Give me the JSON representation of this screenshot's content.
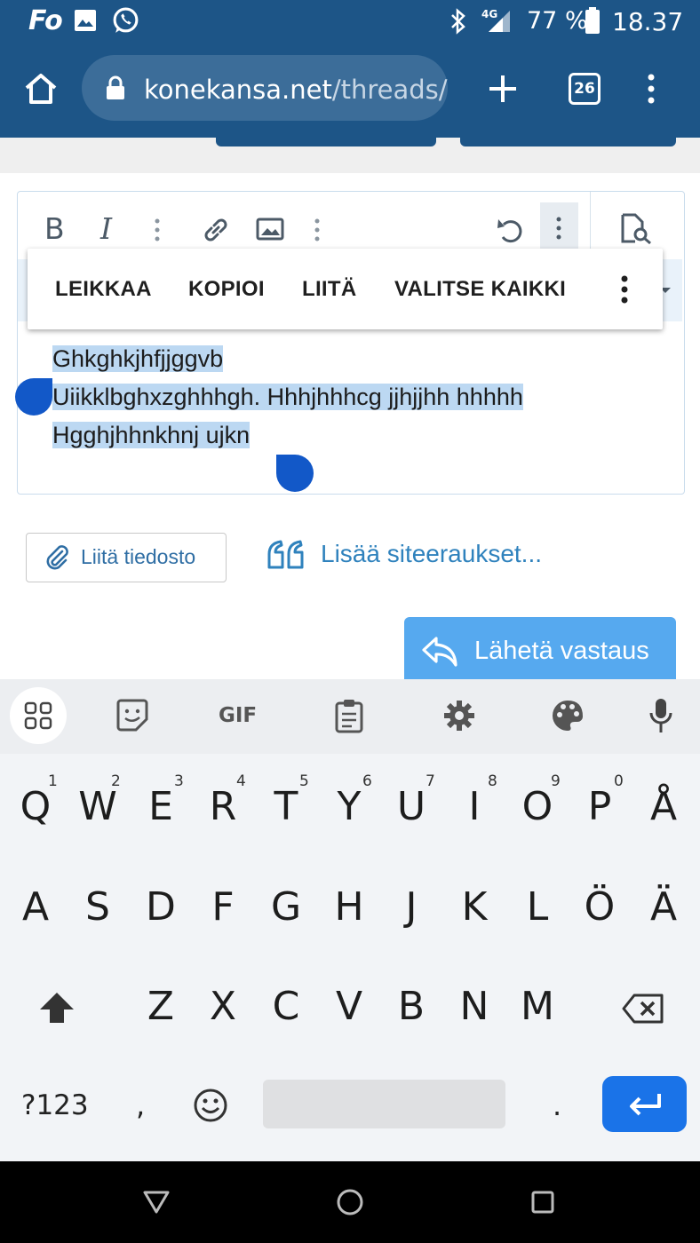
{
  "status_bar": {
    "app_label": "Fo",
    "network": "4G",
    "battery": "77 %",
    "time": "18.37"
  },
  "browser": {
    "url_host": "konekansa.net",
    "url_path": "/threads/",
    "tab_count": "26"
  },
  "context_menu": {
    "items": [
      "LEIKKAA",
      "KOPIOI",
      "LIITÄ",
      "VALITSE KAIKKI"
    ]
  },
  "editor": {
    "lines": [
      "Ghkghkjhfjjggvb",
      "Uiikklbghxzghhhgh. Hhhjhhhcg jjhjjhh hhhhh",
      "Hgghjhhnkhnj ujkn"
    ]
  },
  "actions": {
    "attach_label": "Liitä tiedosto",
    "quote_label": "Lisää siteeraukset...",
    "send_label": "Lähetä vastaus"
  },
  "keyboard": {
    "toolbar": [
      "apps-icon",
      "sticker-icon",
      "GIF",
      "clipboard-icon",
      "settings-icon",
      "palette-icon",
      "mic-icon"
    ],
    "row1": [
      "Q",
      "W",
      "E",
      "R",
      "T",
      "Y",
      "U",
      "I",
      "O",
      "P",
      "Å"
    ],
    "row1_hints": [
      "1",
      "2",
      "3",
      "4",
      "5",
      "6",
      "7",
      "8",
      "9",
      "0"
    ],
    "row2": [
      "A",
      "S",
      "D",
      "F",
      "G",
      "H",
      "J",
      "K",
      "L",
      "Ö",
      "Ä"
    ],
    "row3": [
      "Z",
      "X",
      "C",
      "V",
      "B",
      "N",
      "M"
    ],
    "symbols_label": "?123",
    "comma": ",",
    "period": "."
  },
  "colors": {
    "chrome": "#1d5587",
    "accent": "#1a73e8",
    "send": "#56a9ef"
  }
}
